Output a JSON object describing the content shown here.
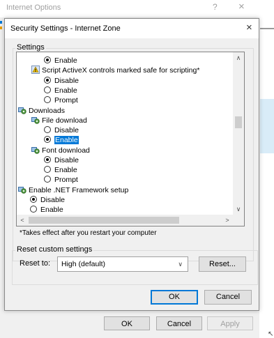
{
  "background_window": {
    "title": "Internet Options",
    "help_label": "?",
    "close_label": "×",
    "buttons": {
      "ok": "OK",
      "cancel": "Cancel",
      "apply": "Apply"
    }
  },
  "dialog": {
    "title": "Security Settings - Internet Zone",
    "close_label": "×",
    "settings_group_label": "Settings",
    "settings_items": [
      {
        "type": "radio",
        "label": "Enable",
        "checked": true
      },
      {
        "type": "category",
        "label": "Script ActiveX controls marked safe for scripting*",
        "icon": "shield-warning-icon"
      },
      {
        "type": "radio",
        "label": "Disable",
        "checked": true
      },
      {
        "type": "radio",
        "label": "Enable",
        "checked": false
      },
      {
        "type": "radio",
        "label": "Prompt",
        "checked": false
      },
      {
        "type": "category",
        "label": "Downloads",
        "icon": "settings-gear-icon"
      },
      {
        "type": "category",
        "label": "File download",
        "icon": "settings-gear-icon"
      },
      {
        "type": "radio",
        "label": "Disable",
        "checked": false
      },
      {
        "type": "radio",
        "label": "Enable",
        "checked": true,
        "selected": true
      },
      {
        "type": "category",
        "label": "Font download",
        "icon": "settings-gear-icon"
      },
      {
        "type": "radio",
        "label": "Disable",
        "checked": true
      },
      {
        "type": "radio",
        "label": "Enable",
        "checked": false
      },
      {
        "type": "radio",
        "label": "Prompt",
        "checked": false
      },
      {
        "type": "category",
        "label": "Enable .NET Framework setup",
        "icon": "settings-gear-icon"
      },
      {
        "type": "radio",
        "label": "Disable",
        "checked": true
      },
      {
        "type": "radio",
        "label": "Enable",
        "checked": false
      }
    ],
    "note": "*Takes effect after you restart your computer",
    "reset_group_label": "Reset custom settings",
    "reset_to_label": "Reset to:",
    "reset_select_value": "High (default)",
    "reset_button": "Reset...",
    "ok_button": "OK",
    "cancel_button": "Cancel"
  },
  "colors": {
    "accent": "#0078d7",
    "window_bg": "#f0f0f0",
    "selection": "#0078d7"
  }
}
